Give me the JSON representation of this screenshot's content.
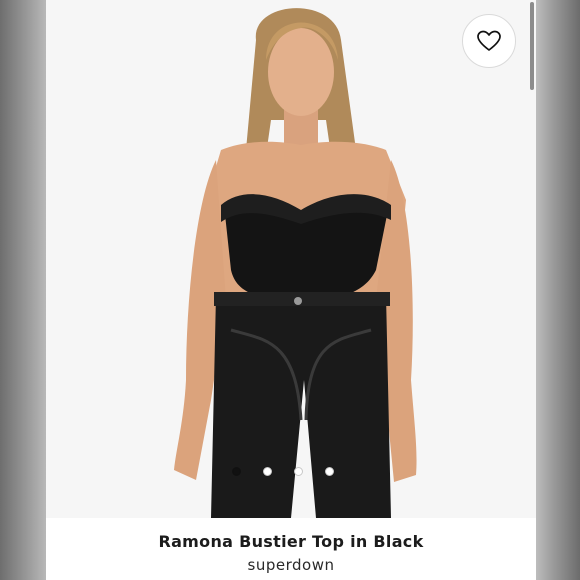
{
  "product": {
    "name": "Ramona Bustier Top in Black",
    "brand": "superdown"
  },
  "gallery": {
    "image_count": 4,
    "active_index": 0
  },
  "actions": {
    "favorite_icon": "heart-outline-icon"
  },
  "colors": {
    "active_dot": "#111111",
    "inactive_dot": "#ffffff",
    "text": "#1c1c1c"
  }
}
